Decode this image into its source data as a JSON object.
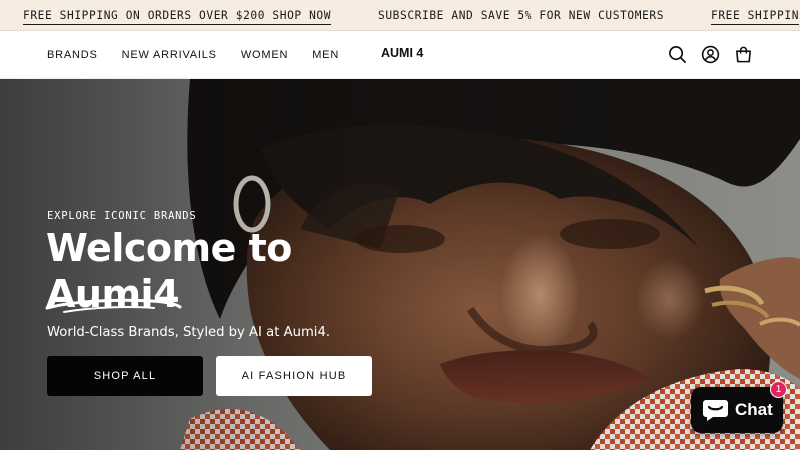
{
  "announcement": {
    "items": [
      "FREE SHIPPING ON ORDERS OVER $200 SHOP NOW",
      "SUBSCRIBE AND SAVE 5% FOR NEW CUSTOMERS",
      "FREE SHIPPIN"
    ]
  },
  "header": {
    "nav": [
      "BRANDS",
      "NEW ARRIVAILS",
      "WOMEN",
      "MEN"
    ],
    "logo": "AUMI 4",
    "icons": [
      "search-icon",
      "account-icon",
      "cart-icon"
    ]
  },
  "hero": {
    "eyebrow": "EXPLORE ICONIC BRANDS",
    "headline_line1": "Welcome to",
    "headline_line2": "Aumi4",
    "subtitle": "World-Class Brands, Styled by AI at Aumi4.",
    "primary_button": "SHOP ALL",
    "secondary_button": "AI FASHION HUB"
  },
  "chat": {
    "label": "Chat",
    "badge_count": "1"
  },
  "colors": {
    "announcement_bg": "#f7ece2",
    "button_dark": "#050505",
    "badge": "#e0245e"
  }
}
